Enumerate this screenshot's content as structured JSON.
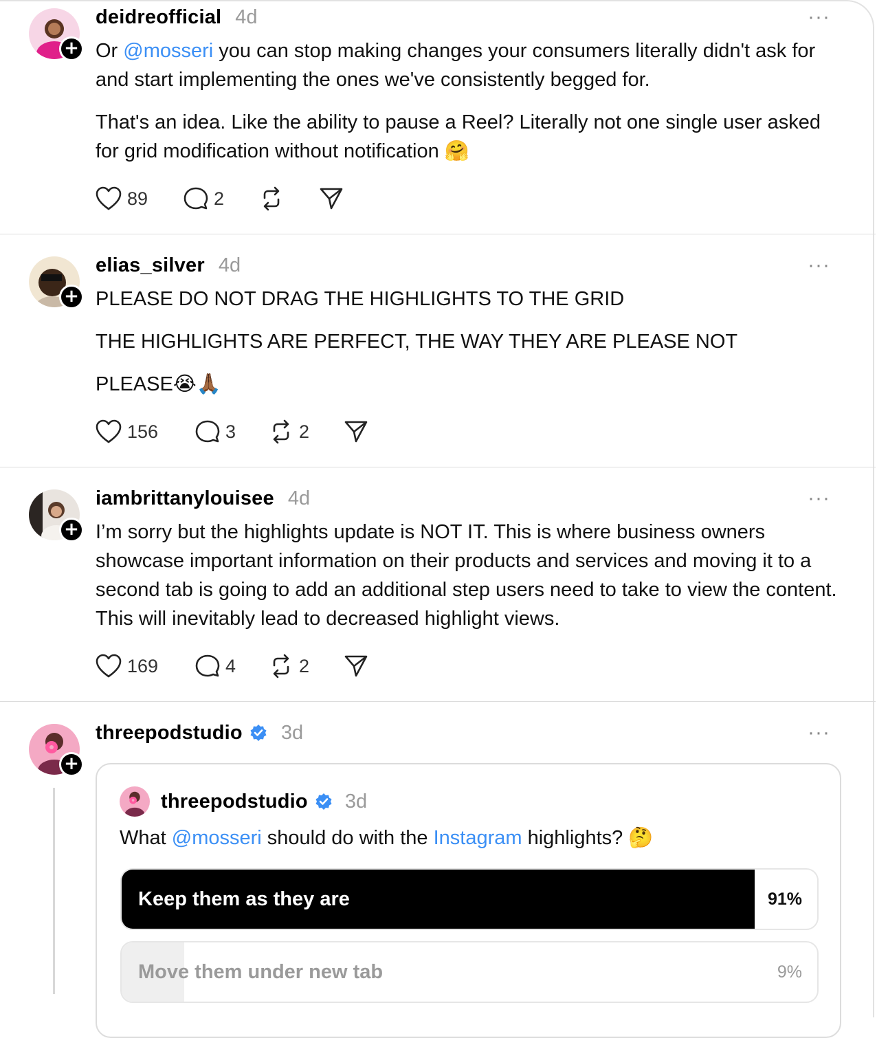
{
  "posts": [
    {
      "username": "deidreofficial",
      "time": "4d",
      "more": "···",
      "para1_a": "Or ",
      "para1_mention": "@mosseri",
      "para1_b": " you can stop making changes your consumers literally didn't ask for and start implementing the ones we've consistently begged for.",
      "para2": "That's an idea. Like the ability to pause a Reel? Literally not one single user asked for grid modification without notification 🤗",
      "likes": "89",
      "replies": "2",
      "reposts": ""
    },
    {
      "username": "elias_silver",
      "time": "4d",
      "more": "···",
      "para1": "PLEASE DO NOT DRAG THE HIGHLIGHTS TO THE GRID",
      "para2": "THE HIGHLIGHTS ARE PERFECT, THE WAY THEY ARE PLEASE NOT",
      "para3": "PLEASE😭🙏🏾",
      "likes": "156",
      "replies": "3",
      "reposts": "2"
    },
    {
      "username": "iambrittanylouisee",
      "time": "4d",
      "more": "···",
      "para1": "I’m sorry but the highlights update is NOT IT. This is where business owners showcase important information on their products and services and moving it to a second tab is going to add an additional step users need to take to view the content. This will inevitably lead to decreased highlight views.",
      "likes": "169",
      "replies": "4",
      "reposts": "2"
    },
    {
      "username": "threepodstudio",
      "time": "3d",
      "more": "···",
      "quote": {
        "username": "threepodstudio",
        "time": "3d",
        "text_a": "What ",
        "mention1": "@mosseri",
        "text_b": " should do with the ",
        "mention2": "Instagram",
        "text_c": " highlights? 🤔",
        "poll": [
          {
            "label": "Keep them as they are",
            "pct": "91%",
            "fraction": 0.91
          },
          {
            "label": "Move them under new tab",
            "pct": "9%",
            "fraction": 0.09
          }
        ]
      }
    }
  ],
  "colors": {
    "accent": "#3b8ff5",
    "muted": "#9a9a9a",
    "divider": "#dcdcdc"
  },
  "icons": [
    "heart-icon",
    "comment-icon",
    "repost-icon",
    "share-icon",
    "verified-icon",
    "more-icon",
    "follow-plus-icon"
  ]
}
